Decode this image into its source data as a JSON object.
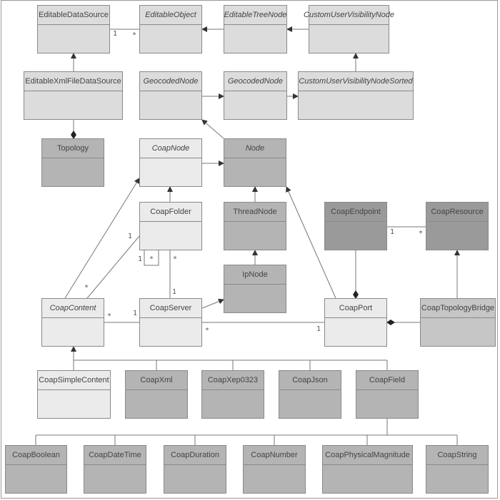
{
  "classes": [
    {
      "name": "EditableDataSource",
      "italic": false,
      "shade": "#dcdcdc"
    },
    {
      "name": "EditableObject",
      "italic": true,
      "shade": "#dcdcdc"
    },
    {
      "name": "EditableTreeNode",
      "italic": true,
      "shade": "#dcdcdc"
    },
    {
      "name": "CustomUserVisibilityNode",
      "italic": true,
      "shade": "#dcdcdc"
    },
    {
      "name": "EditableXmlFileDataSource",
      "italic": false,
      "shade": "#dcdcdc"
    },
    {
      "name": "GeocodedNode",
      "italic": true,
      "shade": "#dcdcdc"
    },
    {
      "name": "GeocodedNode",
      "italic": true,
      "shade": "#dcdcdc"
    },
    {
      "name": "CustomUserVisibilityNodeSorted",
      "italic": true,
      "shade": "#dcdcdc"
    },
    {
      "name": "Topology",
      "italic": false,
      "shade": "#b4b4b4"
    },
    {
      "name": "CoapNode",
      "italic": true,
      "shade": "#ebebeb"
    },
    {
      "name": "Node",
      "italic": true,
      "shade": "#b4b4b4"
    },
    {
      "name": "CoapFolder",
      "italic": false,
      "shade": "#ebebeb"
    },
    {
      "name": "ThreadNode",
      "italic": false,
      "shade": "#b4b4b4"
    },
    {
      "name": "CoapEndpoint",
      "italic": false,
      "shade": "#9a9a9a"
    },
    {
      "name": "CoapResource",
      "italic": false,
      "shade": "#9a9a9a"
    },
    {
      "name": "IpNode",
      "italic": false,
      "shade": "#b4b4b4"
    },
    {
      "name": "CoapContent",
      "italic": true,
      "shade": "#ebebeb"
    },
    {
      "name": "CoapServer",
      "italic": false,
      "shade": "#ebebeb"
    },
    {
      "name": "CoapPort",
      "italic": false,
      "shade": "#ebebeb"
    },
    {
      "name": "CoapTopologyBridge",
      "italic": false,
      "shade": "#c6c6c6"
    },
    {
      "name": "CoapSimpleContent",
      "italic": false,
      "shade": "#ebebeb"
    },
    {
      "name": "CoapXml",
      "italic": false,
      "shade": "#b4b4b4"
    },
    {
      "name": "CoapXep0323",
      "italic": false,
      "shade": "#b4b4b4"
    },
    {
      "name": "CoapJson",
      "italic": false,
      "shade": "#b4b4b4"
    },
    {
      "name": "CoapField",
      "italic": false,
      "shade": "#b4b4b4"
    },
    {
      "name": "CoapBoolean",
      "italic": false,
      "shade": "#b4b4b4"
    },
    {
      "name": "CoapDateTime",
      "italic": false,
      "shade": "#b4b4b4"
    },
    {
      "name": "CoapDuration",
      "italic": false,
      "shade": "#b4b4b4"
    },
    {
      "name": "CoapNumber",
      "italic": false,
      "shade": "#b4b4b4"
    },
    {
      "name": "CoapPhysicalMagnitude",
      "italic": false,
      "shade": "#b4b4b4"
    },
    {
      "name": "CoapString",
      "italic": false,
      "shade": "#b4b4b4"
    }
  ],
  "multiplicities": {
    "datasource_one": "1",
    "datasource_many": "*",
    "folder_content_one": "1",
    "folder_content_many": "*",
    "folder_self_one": "1",
    "folder_self_many": "*",
    "folder_server_many": "*",
    "folder_server_one": "1",
    "content_server_many": "*",
    "content_server_one": "1",
    "server_port_many": "*",
    "server_port_one": "1",
    "endpoint_resource_one": "1",
    "endpoint_resource_many": "*"
  }
}
